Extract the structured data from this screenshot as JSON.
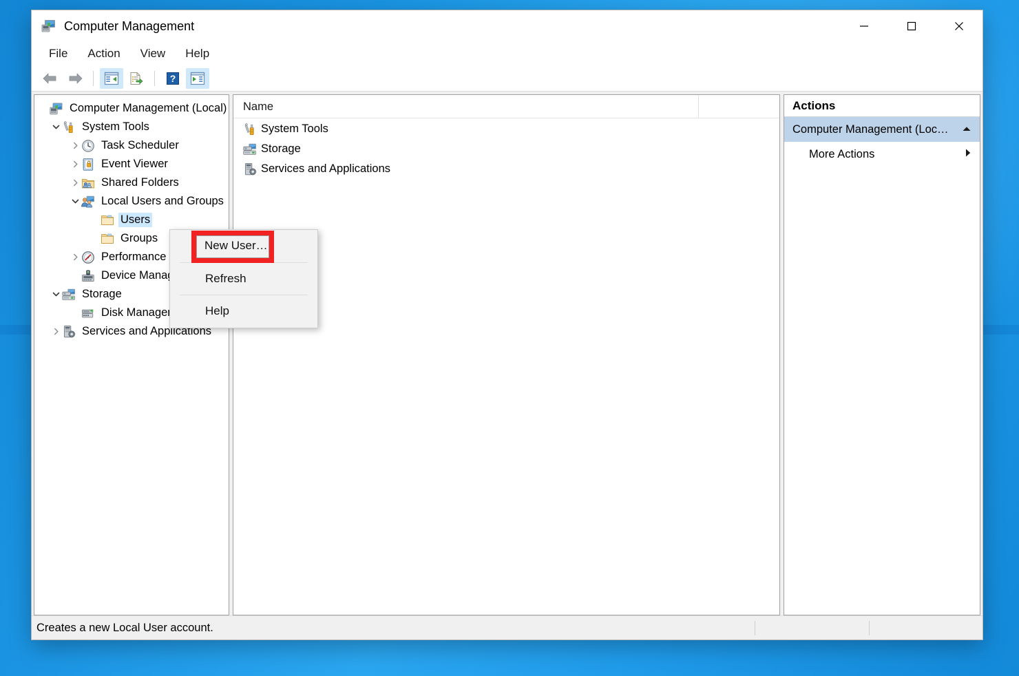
{
  "window": {
    "title": "Computer Management",
    "icon": "computer-management-icon",
    "controls": {
      "minimize": "minimize-icon",
      "maximize": "maximize-icon",
      "close": "close-icon"
    }
  },
  "menubar": {
    "items": [
      {
        "label": "File"
      },
      {
        "label": "Action"
      },
      {
        "label": "View"
      },
      {
        "label": "Help"
      }
    ]
  },
  "toolbar": {
    "buttons": [
      {
        "name": "back-icon",
        "active": false
      },
      {
        "name": "forward-icon",
        "active": false
      },
      {
        "name": "show-console-tree-icon",
        "active": true
      },
      {
        "name": "export-list-icon",
        "active": false
      },
      {
        "name": "help-icon",
        "active": false
      },
      {
        "name": "show-action-pane-icon",
        "active": true
      }
    ]
  },
  "tree": {
    "nodes": [
      {
        "label": "Computer Management (Local)",
        "icon": "computer-icon",
        "indent": 0,
        "twist": "none",
        "selected": false
      },
      {
        "label": "System Tools",
        "icon": "system-tools-icon",
        "indent": 1,
        "twist": "expanded",
        "selected": false
      },
      {
        "label": "Task Scheduler",
        "icon": "clock-icon",
        "indent": 2,
        "twist": "collapsed",
        "selected": false
      },
      {
        "label": "Event Viewer",
        "icon": "event-viewer-icon",
        "indent": 2,
        "twist": "collapsed",
        "selected": false
      },
      {
        "label": "Shared Folders",
        "icon": "shared-folders-icon",
        "indent": 2,
        "twist": "collapsed",
        "selected": false
      },
      {
        "label": "Local Users and Groups",
        "icon": "local-users-icon",
        "indent": 2,
        "twist": "expanded",
        "selected": false
      },
      {
        "label": "Users",
        "icon": "folder-icon",
        "indent": 3,
        "twist": "none",
        "selected": true
      },
      {
        "label": "Groups",
        "icon": "folder-icon",
        "indent": 3,
        "twist": "none",
        "selected": false
      },
      {
        "label": "Performance",
        "icon": "performance-icon",
        "indent": 2,
        "twist": "collapsed",
        "selected": false
      },
      {
        "label": "Device Manager",
        "icon": "device-manager-icon",
        "indent": 2,
        "twist": "none",
        "selected": false
      },
      {
        "label": "Storage",
        "icon": "storage-icon",
        "indent": 1,
        "twist": "expanded",
        "selected": false
      },
      {
        "label": "Disk Management",
        "icon": "disk-management-icon",
        "indent": 2,
        "twist": "none",
        "selected": false
      },
      {
        "label": "Services and Applications",
        "icon": "services-icon",
        "indent": 1,
        "twist": "collapsed",
        "selected": false
      }
    ]
  },
  "list": {
    "columns": [
      {
        "label": "Name"
      },
      {
        "label": ""
      }
    ],
    "rows": [
      {
        "label": "System Tools",
        "icon": "system-tools-icon"
      },
      {
        "label": "Storage",
        "icon": "storage-icon"
      },
      {
        "label": "Services and Applications",
        "icon": "services-icon"
      }
    ]
  },
  "actions": {
    "title": "Actions",
    "group_label": "Computer Management (Loc…",
    "group_chevron": "chevron-up-icon",
    "items": [
      {
        "label": "More Actions",
        "arrow": "arrow-right-icon"
      }
    ]
  },
  "context_menu": {
    "items": [
      {
        "label": "New User…",
        "type": "item",
        "highlighted": true
      },
      {
        "type": "separator"
      },
      {
        "label": "Refresh",
        "type": "item",
        "highlighted": false
      },
      {
        "type": "separator"
      },
      {
        "label": "Help",
        "type": "item",
        "highlighted": false
      }
    ],
    "highlight_color": "#f32222"
  },
  "statusbar": {
    "text": "Creates a new Local User account."
  },
  "colors": {
    "desktop": "#1b95e3",
    "selection": "#cce8ff",
    "actions_group": "#bdd3e9",
    "toolbar_active": "#cfe8fa",
    "annotation_red": "#f32222"
  }
}
